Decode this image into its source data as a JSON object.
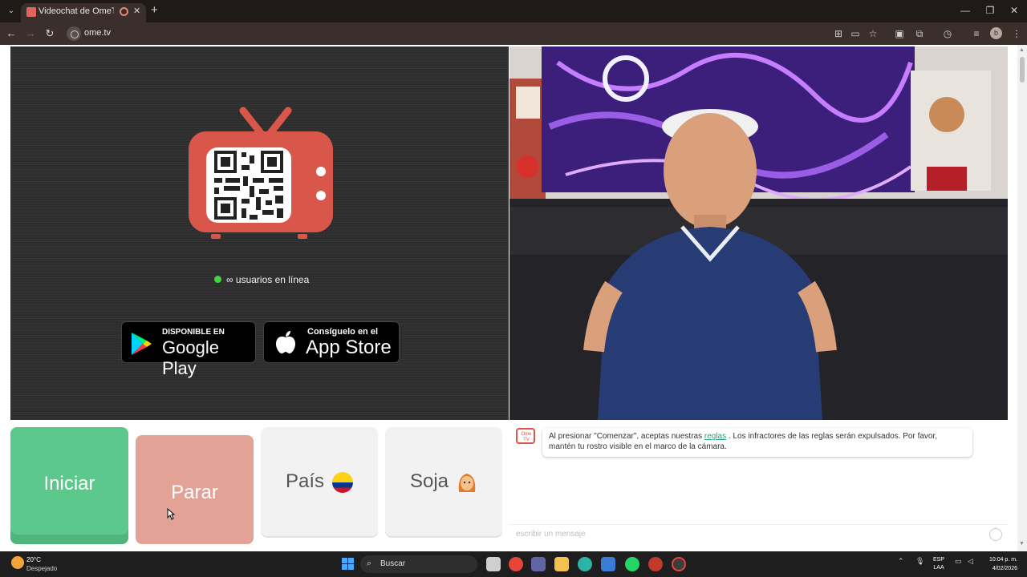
{
  "browser": {
    "tab_title": "Videochat de OmeTV: uno",
    "url": "ome.tv"
  },
  "main": {
    "online_text": "∞ usuarios en línea",
    "google_play": {
      "small": "DISPONIBLE EN",
      "big": "Google Play"
    },
    "app_store": {
      "small": "Consíguelo en el",
      "big": "App Store"
    },
    "buttons": {
      "start": "Iniciar",
      "stop": "Parar",
      "country": "País",
      "gender": "Soja"
    },
    "colors": {
      "start": "#5cc88c",
      "stop": "#e3a296",
      "logo_red": "#d8574a"
    }
  },
  "chat": {
    "logo_text": "Ome TV",
    "message_before": "Al presionar \"Comenzar\", aceptas nuestras",
    "message_link": "reglas",
    "message_after": ". Los infractores de las reglas serán expulsados. Por favor, mantén tu rostro visible en el marco de la cámara.",
    "placeholder": "escribir un mensaje"
  },
  "taskbar": {
    "temperature": "20°C",
    "condition": "Despejado",
    "search": "Buscar",
    "language": "ESP",
    "language_sub": "LAA",
    "time": "10:04 p. m.",
    "date": "4/02/2026"
  }
}
